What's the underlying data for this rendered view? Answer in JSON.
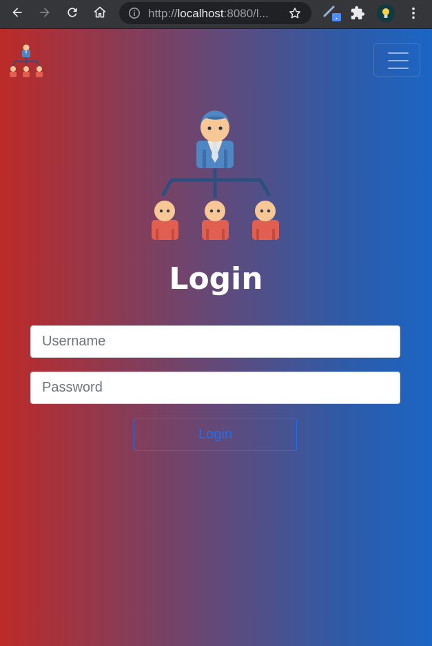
{
  "browser": {
    "url_scheme": "http://",
    "url_host": "localhost",
    "url_rest": ":8080/l...",
    "icons": {
      "back": "back-arrow-icon",
      "forward": "forward-arrow-icon",
      "reload": "reload-icon",
      "home": "home-icon",
      "info": "info-icon",
      "bookmark": "star-icon",
      "extension1": "pen-extension-icon",
      "extensions": "puzzle-icon",
      "extension2": "lightbulb-extension-icon",
      "menu": "kebab-menu-icon"
    }
  },
  "navbar": {
    "brand_icon": "org-chart-icon",
    "toggler_icon": "hamburger-icon"
  },
  "login": {
    "hero_icon": "org-chart-icon",
    "title": "Login",
    "username_placeholder": "Username",
    "password_placeholder": "Password",
    "submit_label": "Login"
  },
  "colors": {
    "gradient_left": "#bd2a28",
    "gradient_right": "#1b65c4",
    "button_accent": "#1d6ff2",
    "manager_blue": "#4f87c4",
    "employee_red": "#e05f50",
    "skin": "#f7c896"
  }
}
